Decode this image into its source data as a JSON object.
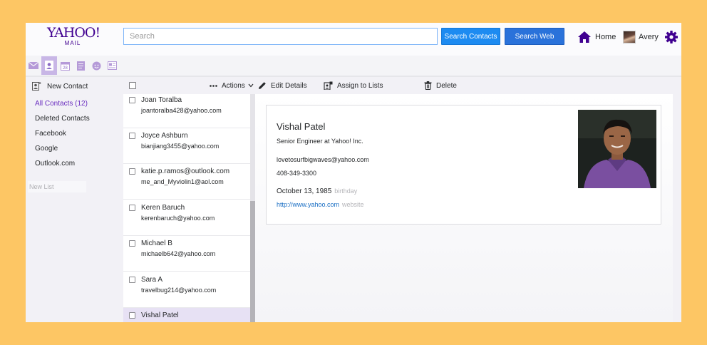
{
  "logo": {
    "brand": "YAHOO!",
    "sub": "MAIL"
  },
  "search": {
    "placeholder": "Search",
    "contacts_btn": "Search Contacts",
    "web_btn": "Search Web"
  },
  "header": {
    "home_label": "Home",
    "user_name": "Avery"
  },
  "colors": {
    "brand_purple": "#400090",
    "primary_blue": "#1d8bf1",
    "selected_row": "#e7e1f4",
    "background": "#fdc664"
  },
  "apps": [
    {
      "name": "mail-icon",
      "active": false
    },
    {
      "name": "contacts-icon",
      "active": true
    },
    {
      "name": "calendar-icon",
      "label": "28",
      "active": false
    },
    {
      "name": "notepad-icon",
      "active": false
    },
    {
      "name": "messenger-icon",
      "active": false
    },
    {
      "name": "newsfeed-icon",
      "active": false
    }
  ],
  "sidebar": {
    "new_contact": "New Contact",
    "folders": [
      "All Contacts (12)",
      "Deleted Contacts",
      "Facebook",
      "Google",
      "Outlook.com"
    ],
    "new_list_placeholder": "New List"
  },
  "toolbar": {
    "actions": "Actions",
    "edit": "Edit Details",
    "assign": "Assign to Lists",
    "delete": "Delete"
  },
  "contacts": [
    {
      "name": "Joan Toralba",
      "email": "joantoralba428@yahoo.com"
    },
    {
      "name": "Joyce Ashburn",
      "email": "bianjiang3455@yahoo.com"
    },
    {
      "name": "katie.p.ramos@outlook.com",
      "email": "me_and_Myviolin1@aol.com"
    },
    {
      "name": "Keren Baruch",
      "email": "kerenbaruch@yahoo.com"
    },
    {
      "name": "Michael B",
      "email": "michaelb642@yahoo.com"
    },
    {
      "name": "Sara A",
      "email": "travelbug214@yahoo.com"
    },
    {
      "name": "Vishal Patel",
      "email": ""
    }
  ],
  "selected_contact": {
    "name": "Vishal Patel",
    "title": "Senior Engineer at Yahoo! Inc.",
    "email": "lovetosurfbigwaves@yahoo.com",
    "phone": "408-349-3300",
    "birthday": "October 13, 1985",
    "birthday_label": "birthday",
    "website": "http://www.yahoo.com",
    "website_label": "website"
  }
}
